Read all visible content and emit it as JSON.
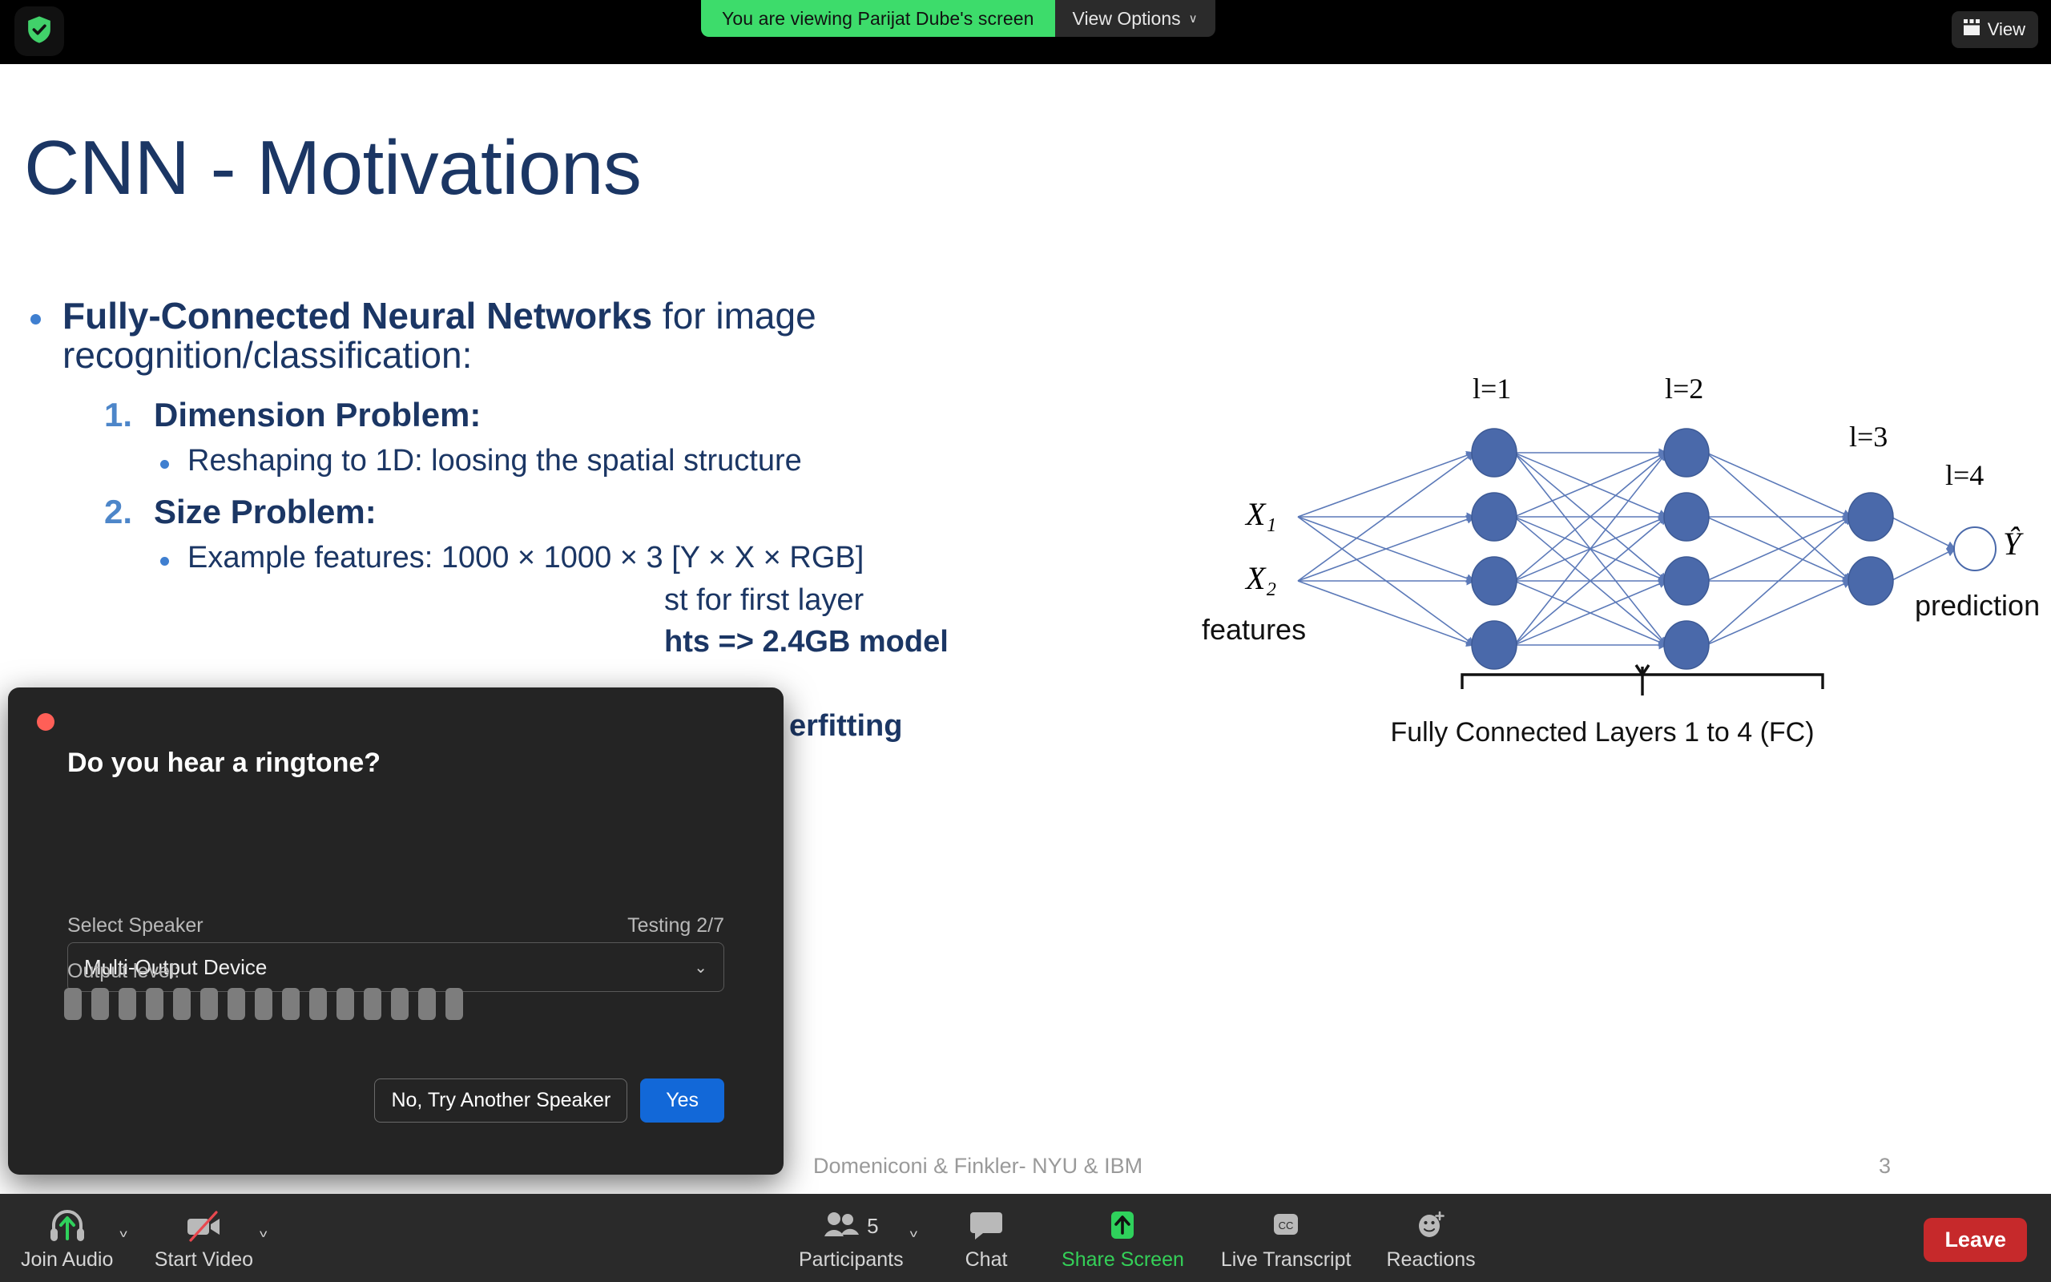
{
  "topbar": {
    "shield_icon": "shield-check-icon",
    "sharing_notice": "You are viewing Parijat Dube's screen",
    "view_options_label": "View Options",
    "view_options_caret": "∨",
    "view_button_label": "View",
    "view_button_icon": "layout-grid-icon",
    "green_hex": "#3ddc6b"
  },
  "slide": {
    "title": "CNN - Motivations",
    "bullet1_bold": "Fully-Connected Neural Networks",
    "bullet1_rest": " for image recognition/classification:",
    "items": [
      {
        "number": "1.",
        "heading": "Dimension Problem:",
        "subs": [
          "Reshaping to 1D: loosing the spatial structure"
        ]
      },
      {
        "number": "2.",
        "heading": "Size Problem:",
        "subs": [
          "Example features: 1000 × 1000 × 3 [Y × X × RGB]",
          "st for first layer",
          "hts  =>  2.4GB model"
        ]
      }
    ],
    "occluded_overfitting": "erfitting",
    "footer_credit": "Domeniconi & Finkler-  NYU & IBM",
    "page_number": "3",
    "title_color": "#1b3664",
    "accent_color": "#3f7fd0"
  },
  "diagram": {
    "layer_labels": [
      "l=1",
      "l=2",
      "l=3",
      "l=4"
    ],
    "input_labels": [
      "X₁",
      "X₂"
    ],
    "features_label": "features",
    "output_label": "Ŷ",
    "prediction_label": "prediction",
    "caption": "Fully Connected Layers 1 to 4 (FC)",
    "node_fill": "#4a69aa",
    "edge_color": "#5b79b8",
    "layer_sizes": [
      4,
      4,
      2,
      1
    ]
  },
  "dialog": {
    "title": "Do you hear a ringtone?",
    "select_speaker_label": "Select Speaker",
    "testing_label": "Testing 2/7",
    "speaker_value": "Multi-Output Device",
    "speaker_chevron": "⌄",
    "output_level_label": "Output level:",
    "meter_segments": 15,
    "button_secondary": "No, Try Another Speaker",
    "button_primary": "Yes",
    "primary_hex": "#1268d8"
  },
  "toolbar": {
    "items": [
      {
        "label": "Join Audio",
        "icon": "headset-arrow-up-icon",
        "has_caret": true,
        "green": false
      },
      {
        "label": "Start Video",
        "icon": "camera-off-icon",
        "has_caret": true,
        "green": false
      },
      {
        "label": "Participants",
        "icon": "people-icon",
        "has_caret": true,
        "green": false,
        "count": "5"
      },
      {
        "label": "Chat",
        "icon": "chat-bubble-icon",
        "has_caret": false,
        "green": false
      },
      {
        "label": "Share Screen",
        "icon": "share-screen-arrow-up-icon",
        "has_caret": false,
        "green": true
      },
      {
        "label": "Live Transcript",
        "icon": "closed-caption-icon",
        "has_caret": false,
        "green": false
      },
      {
        "label": "Reactions",
        "icon": "smiley-plus-icon",
        "has_caret": false,
        "green": false
      }
    ],
    "leave_label": "Leave",
    "leave_hex": "#c6292b"
  }
}
